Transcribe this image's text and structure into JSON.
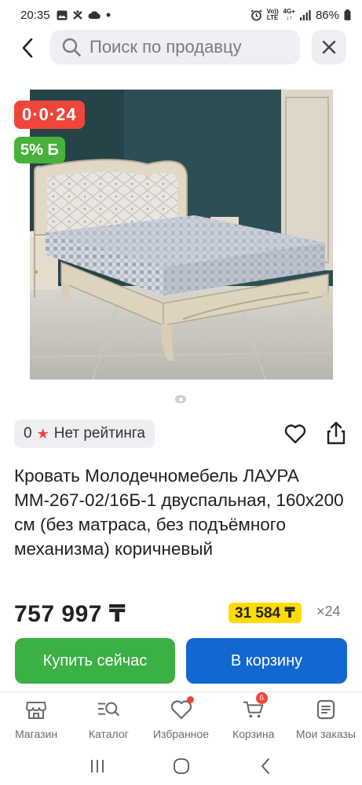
{
  "status_bar": {
    "time": "20:35",
    "network_top": "Vo))",
    "network_bottom": "LTE",
    "data_top": "4G+",
    "data_bottom": "↓↑",
    "battery": "86%"
  },
  "search": {
    "placeholder": "Поиск по продавцу"
  },
  "badges": {
    "installment": "0·0·24",
    "bonus": "5% Б"
  },
  "rating": {
    "value": "0",
    "text": "Нет рейтинга"
  },
  "product": {
    "title": "Кровать Молодечномебель ЛАУРА ММ-267-02/16Б-1 двуспальная, 160x200 см (без матраса, без подъёмного механизма) коричневый",
    "price": "757 997 ₸",
    "installment_price": "31 584 ₸",
    "installment_months": "×24"
  },
  "actions": {
    "buy_now": "Купить сейчас",
    "add_to_cart": "В корзину"
  },
  "bottom_nav": {
    "items": [
      {
        "label": "Магазин",
        "icon": "shop-icon"
      },
      {
        "label": "Каталог",
        "icon": "catalog-icon"
      },
      {
        "label": "Избранное",
        "icon": "heart-icon"
      },
      {
        "label": "Корзина",
        "icon": "cart-icon",
        "badge": "6"
      },
      {
        "label": "Мои заказы",
        "icon": "orders-icon"
      }
    ]
  },
  "colors": {
    "installment_badge": "#f0453a",
    "bonus_badge": "#47b23b",
    "buy_now": "#3bb045",
    "add_to_cart": "#1367d0",
    "installment_price_bg": "#ffdc00"
  }
}
